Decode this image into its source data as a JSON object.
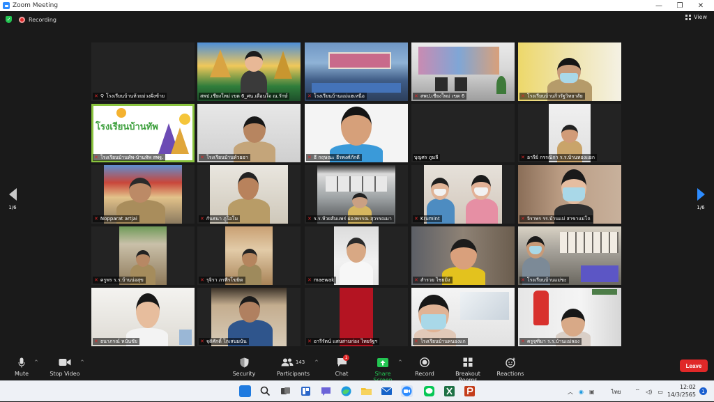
{
  "window": {
    "title": "Zoom Meeting",
    "minimize": "—",
    "maximize": "❐",
    "close": "✕"
  },
  "topbar": {
    "recording_label": "Recording",
    "view_label": "View"
  },
  "pager": {
    "left": "1/6",
    "right": "1/6"
  },
  "participants": [
    {
      "name": "โรงเรียนบ้านห้วยม่วงฝั่งซ้าย",
      "pinned": true
    },
    {
      "name": "สพป.เชียงใหม่ เขต 6_ศน.เตือนใจ ณ.รักษ์"
    },
    {
      "name": "โรงเรียนบ้านแม่แฮเหนือ"
    },
    {
      "name": "สพป.เชียงใหม่ เขต 6"
    },
    {
      "name": "โรงเรียนบ้านกิ่วรัฐวิทยาลัย"
    },
    {
      "name": "โรงเรียนบ้านทัพ-บ้านทัพ สพฐ.",
      "logo_text": "โรงเรียนบ้านทัพ"
    },
    {
      "name": "โรงเรียนบ้านห้วยอา"
    },
    {
      "name": "ธี กฤษณะ ธีรพงศ์ภักดี"
    },
    {
      "name": "บุญศร ภูมลี"
    },
    {
      "name": "อารีย์ กรรณิกา ร.ร.บ้านทองแยก"
    },
    {
      "name": "Nopparat artjai"
    },
    {
      "name": "กันธนา ภูโอโม"
    },
    {
      "name": "ร.ร.ห้วยส้มแพร่ ผ่องพรรณ สุวรรณมา"
    },
    {
      "name": "Krumint"
    },
    {
      "name": "จิราพร รร.บ้านแม่ สาขาแม่โถ"
    },
    {
      "name": "ครูพร ร.ร.บ้านบ่อสุข"
    },
    {
      "name": "รุจิรา ภรพีรโฆษิต"
    },
    {
      "name": "maewak"
    },
    {
      "name": "สำรวย ไชยมิ่ง"
    },
    {
      "name": "โรงเรียนบ้านแม่ขะ"
    },
    {
      "name": "ธนาภรณ์ หนันชัย"
    },
    {
      "name": "จุติศักดิ์ โกเสนมนัน"
    },
    {
      "name": "อารีรัตน์ แสนสามก่อง ไทยรัฐฯ"
    },
    {
      "name": "โรงเรียนบ้านหนองแก"
    },
    {
      "name": "ครูจุฑิมา ร.ร.บ้านแม่ลอง"
    }
  ],
  "toolbar": {
    "mute": "Mute",
    "stop_video": "Stop Video",
    "security": "Security",
    "participants": "Participants",
    "participants_count": "143",
    "chat": "Chat",
    "chat_badge": "1",
    "share_screen": "Share Screen",
    "record": "Record",
    "breakout_rooms": "Breakout Rooms",
    "reactions": "Reactions",
    "leave": "Leave"
  },
  "taskbar": {
    "language": "ไทย",
    "time": "12:02",
    "date": "14/3/2565",
    "notification_count": "1"
  },
  "colors": {
    "accent": "#2d8cff",
    "leave": "#e02828",
    "share": "#23c552",
    "active_speaker": "#b6e05a"
  }
}
